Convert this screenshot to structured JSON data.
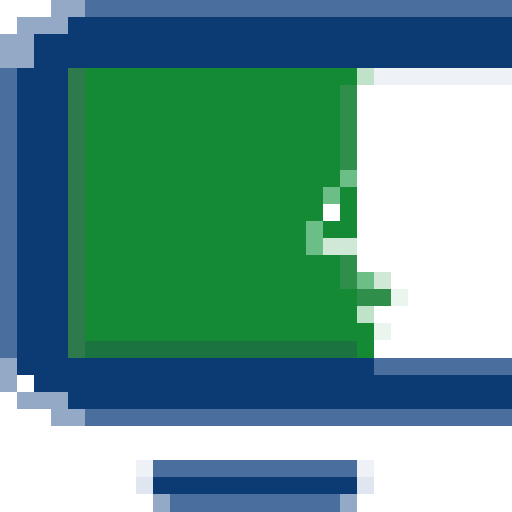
{
  "icon": {
    "name": "battery-icon",
    "charge_fraction": 0.55,
    "colors": {
      "frame_dark": "#0c3b73",
      "frame_light": "#4a6f9f",
      "frame_edge": "#93a9c6",
      "fill_green": "#138a33",
      "fill_green_edge": "#2f7a4c",
      "fill_green_soft": "#6bbf86",
      "background": "#ffffff"
    }
  }
}
